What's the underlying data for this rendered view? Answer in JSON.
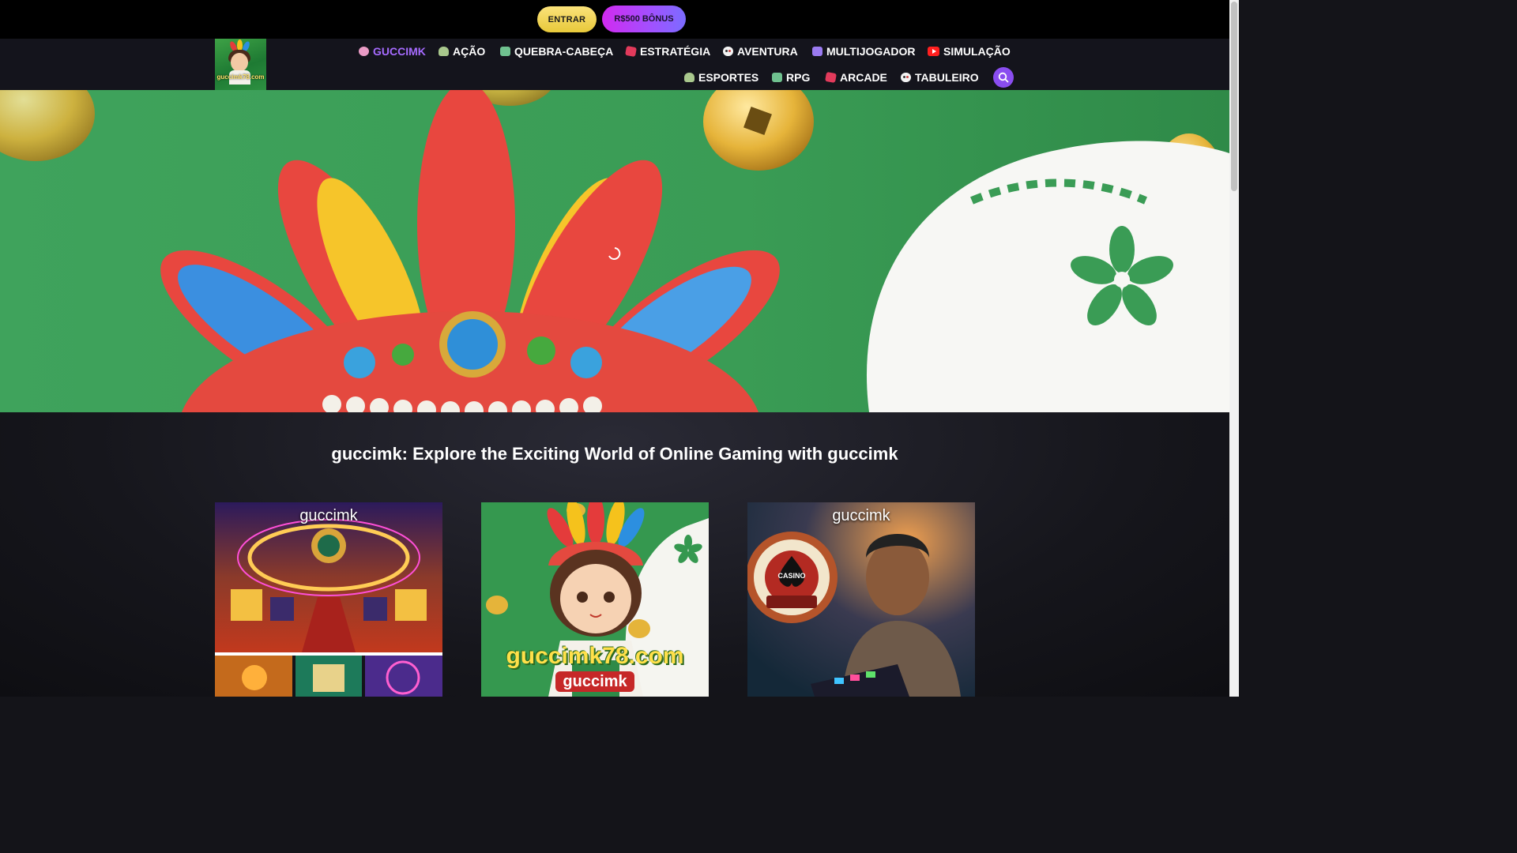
{
  "topbar": {
    "login_label": "ENTRAR",
    "bonus_label": "R$500 BÔNUS"
  },
  "logo": {
    "text": "guccimk78.com"
  },
  "nav": {
    "row1": [
      {
        "label": "GUCCIMK",
        "icon": "joystick-icon",
        "active": true
      },
      {
        "label": "AÇÃO",
        "icon": "cap-icon"
      },
      {
        "label": "QUEBRA-CABEÇA",
        "icon": "robot-icon"
      },
      {
        "label": "ESTRATÉGIA",
        "icon": "dice-icon"
      },
      {
        "label": "AVENTURA",
        "icon": "gamepad-icon"
      },
      {
        "label": "MULTIJOGADOR",
        "icon": "tv-icon"
      },
      {
        "label": "SIMULAÇÃO",
        "icon": "youtube-icon"
      }
    ],
    "row2": [
      {
        "label": "ESPORTES",
        "icon": "cap-icon"
      },
      {
        "label": "RPG",
        "icon": "robot-icon"
      },
      {
        "label": "ARCADE",
        "icon": "dice-icon"
      },
      {
        "label": "TABULEIRO",
        "icon": "gamepad-icon"
      }
    ],
    "search_icon": "search-icon"
  },
  "hero": {
    "image": "girl-feather-headdress-banner"
  },
  "main": {
    "title": "guccimk: Explore the Exciting World of Online Gaming with guccimk",
    "cards": [
      {
        "title": "guccimk",
        "image": "casino-hall-collage"
      },
      {
        "title": "guccimk78.com",
        "subtitle": "guccimk",
        "image": "girl-mascot"
      },
      {
        "title": "guccimk",
        "badge": "CASINO",
        "image": "man-with-tablet"
      }
    ]
  },
  "colors": {
    "accent": "#a66bff",
    "bonus": "#c43cf2",
    "entrar": "#f2d450"
  }
}
